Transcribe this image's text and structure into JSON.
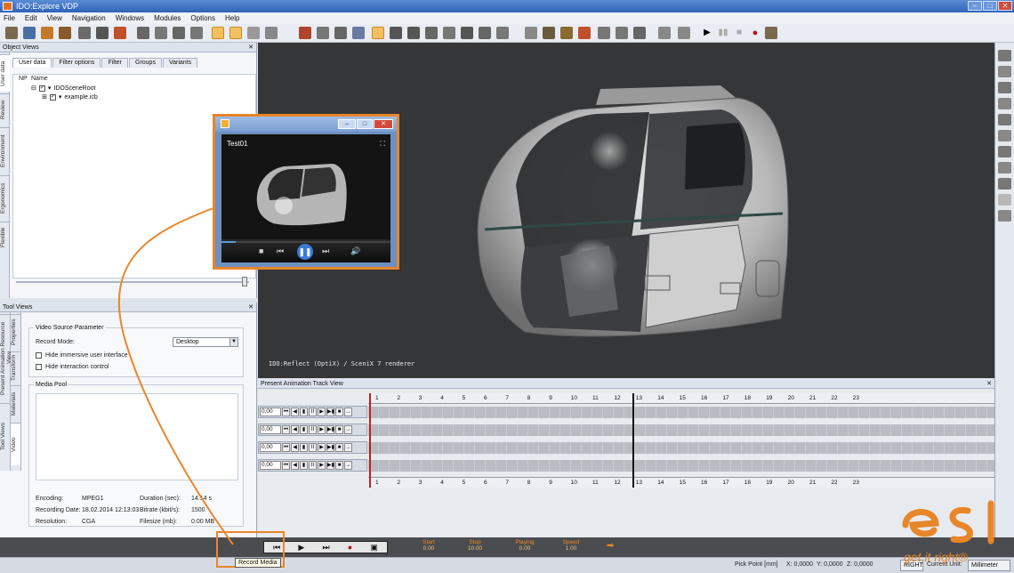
{
  "window": {
    "title": "IDO:Explore VDP",
    "controls": [
      "–",
      "□",
      "✕"
    ]
  },
  "menu": [
    "File",
    "Edit",
    "View",
    "Navigation",
    "Windows",
    "Modules",
    "Options",
    "Help"
  ],
  "object_views": {
    "title": "Object Views",
    "side_tabs": [
      "User data",
      "Review",
      "Environment",
      "Ergonomics",
      "Flexible"
    ],
    "tabs": [
      "User data",
      "Filter options",
      "Filter",
      "Groups",
      "Variants"
    ],
    "columns": [
      "NP",
      "Name"
    ],
    "tree": [
      {
        "label": "IDOSceneRoot",
        "expander": "⊟"
      },
      {
        "label": "example.icb",
        "expander": "⊞"
      }
    ]
  },
  "tool_views": {
    "title": "Tool Views",
    "side_tabs": [
      "Present Animation Resource View",
      "Properties",
      "Transform",
      "Materials",
      "Video",
      "Tool Views"
    ],
    "group_title": "Video Source Parameter",
    "record_mode_label": "Record Mode:",
    "record_mode_value": "Desktop",
    "checkboxes": [
      "Hide immersive user interface",
      "Hide interaction control"
    ],
    "media_pool": "Media Pool",
    "info": [
      {
        "label": "Encoding:",
        "value": "MPEG1",
        "label2": "Duration (sec):",
        "value2": "14.14 s"
      },
      {
        "label": "Recording Date:",
        "value": "18.02.2014 12:13:03",
        "label2": "Bitrate (kbit/s):",
        "value2": "1500"
      },
      {
        "label": "Resolution:",
        "value": "CGA",
        "label2": "Filesize (mb):",
        "value2": "0.00 MB"
      }
    ],
    "buttons": [
      "II",
      "■"
    ]
  },
  "viewport": {
    "renderer_text": "IDO:Reflect (OptiX) / SceniX 7 renderer"
  },
  "popup": {
    "title": "Test01",
    "controls": [
      "–",
      "□",
      "✕"
    ]
  },
  "track_view": {
    "title": "Present Animation Track View",
    "tracks": [
      {
        "value": "0,00"
      },
      {
        "value": "0,00"
      },
      {
        "value": "0,00"
      },
      {
        "value": "0,00"
      }
    ],
    "track_buttons": [
      "⏮",
      "◀",
      "▮",
      "II",
      "▶",
      "▶▮",
      "■",
      "→"
    ],
    "ruler_labels": [
      "1",
      "2",
      "3",
      "4",
      "5",
      "6",
      "7",
      "8",
      "9",
      "10",
      "11",
      "12",
      "13",
      "14",
      "15",
      "16",
      "17",
      "18",
      "19",
      "20",
      "21",
      "22",
      "23"
    ]
  },
  "bottom_controls": {
    "start": {
      "label": "Start",
      "value": "0.00"
    },
    "stop": {
      "label": "Stop",
      "value": "10.00"
    },
    "playing": {
      "label": "Playing",
      "value": "0.00"
    },
    "speed": {
      "label": "Speed",
      "value": "1.00"
    }
  },
  "tooltip": "Record Media",
  "status": {
    "pick_point": "Pick Point [mm]",
    "x": "X: 0,0000",
    "y": "Y: 0,0000",
    "z": "Z: 0,0000",
    "view": "RIGHT",
    "unit_label": "Current Unit:",
    "unit_value": "Millimeter"
  },
  "brand": {
    "tagline": "get it right®",
    "accent": "#e8862a"
  }
}
